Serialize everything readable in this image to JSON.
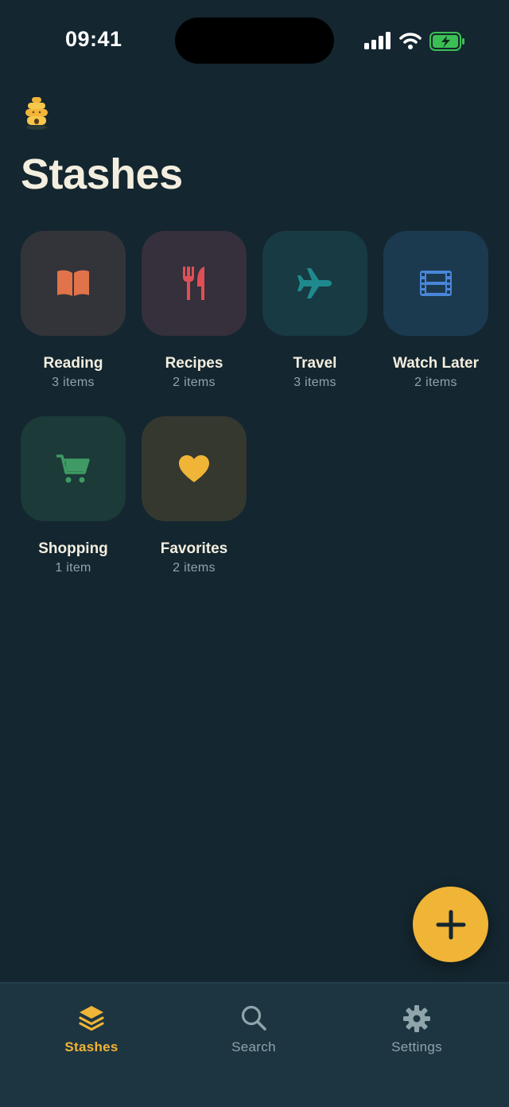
{
  "status": {
    "time": "09:41"
  },
  "header": {
    "title": "Stashes"
  },
  "stashes": [
    {
      "name": "Reading",
      "count": "3 items",
      "icon": "book-icon",
      "color": "#e0734a",
      "tint": "#33343a"
    },
    {
      "name": "Recipes",
      "count": "2 items",
      "icon": "fork-knife-icon",
      "color": "#e04f55",
      "tint": "#35303b"
    },
    {
      "name": "Travel",
      "count": "3 items",
      "icon": "airplane-icon",
      "color": "#1f8a8e",
      "tint": "#183a43"
    },
    {
      "name": "Watch Later",
      "count": "2 items",
      "icon": "film-icon",
      "color": "#4a86d8",
      "tint": "#1b3a50"
    },
    {
      "name": "Shopping",
      "count": "1 item",
      "icon": "cart-icon",
      "color": "#3f9a64",
      "tint": "#1b3a38"
    },
    {
      "name": "Favorites",
      "count": "2 items",
      "icon": "heart-icon",
      "color": "#f0b437",
      "tint": "#34382f"
    }
  ],
  "fab": {
    "icon": "plus-icon",
    "color": "#f0b437"
  },
  "tabs": [
    {
      "label": "Stashes",
      "icon": "stack-icon",
      "active": true
    },
    {
      "label": "Search",
      "icon": "search-icon",
      "active": false
    },
    {
      "label": "Settings",
      "icon": "gear-icon",
      "active": false
    }
  ],
  "colors": {
    "background": "#14262f",
    "accent": "#f0b437",
    "tabbar": "#1c3540",
    "muted": "#8fa4ab"
  }
}
